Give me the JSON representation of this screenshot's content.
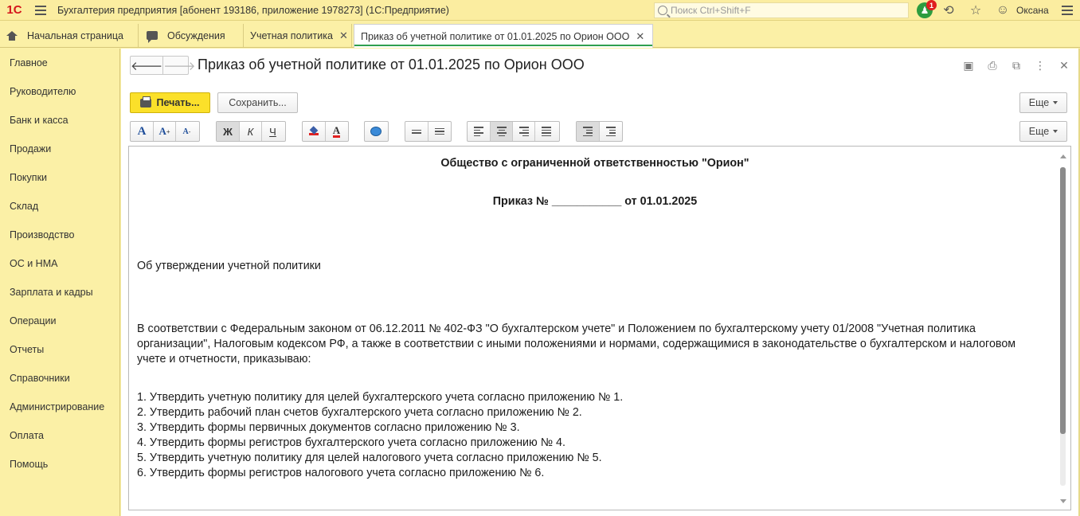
{
  "app": {
    "logo": "1С",
    "title": "Бухгалтерия предприятия [абонент 193186, приложение 1978273]  (1С:Предприятие)",
    "search_placeholder": "Поиск Ctrl+Shift+F",
    "notifications_count": "1",
    "user": "Оксана"
  },
  "tabs": [
    {
      "label": "Начальная страница"
    },
    {
      "label": "Обсуждения"
    },
    {
      "label": "Учетная политика"
    },
    {
      "label": "Приказ об учетной политике от 01.01.2025 по Орион ООО"
    }
  ],
  "sidebar": {
    "items": [
      {
        "label": "Главное"
      },
      {
        "label": "Руководителю"
      },
      {
        "label": "Банк и касса"
      },
      {
        "label": "Продажи"
      },
      {
        "label": "Покупки"
      },
      {
        "label": "Склад"
      },
      {
        "label": "Производство"
      },
      {
        "label": "ОС и НМА"
      },
      {
        "label": "Зарплата и кадры"
      },
      {
        "label": "Операции"
      },
      {
        "label": "Отчеты"
      },
      {
        "label": "Справочники"
      },
      {
        "label": "Администрирование"
      },
      {
        "label": "Оплата"
      },
      {
        "label": "Помощь"
      }
    ]
  },
  "form": {
    "title": "Приказ об учетной политике от 01.01.2025 по Орион ООО",
    "print_label": "Печать...",
    "save_label": "Сохранить...",
    "more_label": "Еще",
    "format": {
      "font_large": "A",
      "font_inc": "A",
      "font_dec": "A",
      "bold": "Ж",
      "italic": "К",
      "underline": "Ч",
      "font_color": "A"
    }
  },
  "document": {
    "org": "Общество с ограниченной ответственностью \"Орион\"",
    "order": "Приказ № ___________ от 01.01.2025",
    "subject": "Об утверждении учетной политики",
    "preamble": "В соответствии с Федеральным законом от 06.12.2011  № 402-ФЗ \"О бухгалтерском учете\" и Положением по бухгалтерскому учету 01/2008 \"Учетная политика организации\", Налоговым кодексом РФ, а также в соответствии с иными положениями и нормами, содержащимися в законодательстве о бухгалтерском и налоговом учете и отчетности, приказываю:",
    "items": [
      "1. Утвердить учетную политику для целей бухгалтерского учета согласно приложению № 1.",
      "2. Утвердить рабочий план счетов бухгалтерского учета согласно приложению № 2.",
      "3. Утвердить формы первичных документов согласно приложению № 3.",
      "4. Утвердить формы регистров бухгалтерского учета согласно приложению № 4.",
      "5. Утвердить учетную политику для целей налогового учета согласно приложению № 5.",
      "6. Утвердить формы регистров налогового учета согласно приложению № 6."
    ]
  }
}
